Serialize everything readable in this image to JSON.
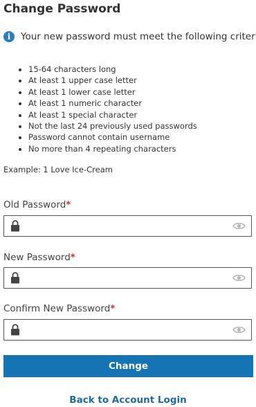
{
  "page": {
    "title": "Change Password"
  },
  "criteria": {
    "intro": "Your new password must meet the following criteria:",
    "items": [
      "15-64 characters long",
      "At least 1 upper case letter",
      "At least 1 lower case letter",
      "At least 1 numeric character",
      "At least 1 special character",
      "Not the last 24 previously used passwords",
      "Password cannot contain username",
      "No more than 4 repeating characters"
    ],
    "example": "Example: 1 Love Ice-Cream"
  },
  "fields": {
    "old": {
      "label": "Old Password",
      "required_mark": "*",
      "value": ""
    },
    "new": {
      "label": "New Password",
      "required_mark": "*",
      "value": ""
    },
    "confirm": {
      "label": "Confirm New Password",
      "required_mark": "*",
      "value": ""
    }
  },
  "actions": {
    "change_label": "Change",
    "back_link": "Back to Account Login"
  },
  "colors": {
    "primary": "#1574b3",
    "link": "#1f6aa5",
    "info": "#2b7bc0",
    "required": "#c0392b"
  },
  "icons": {
    "info": "info-circle-icon",
    "lock": "lock-icon",
    "eye": "eye-icon"
  }
}
